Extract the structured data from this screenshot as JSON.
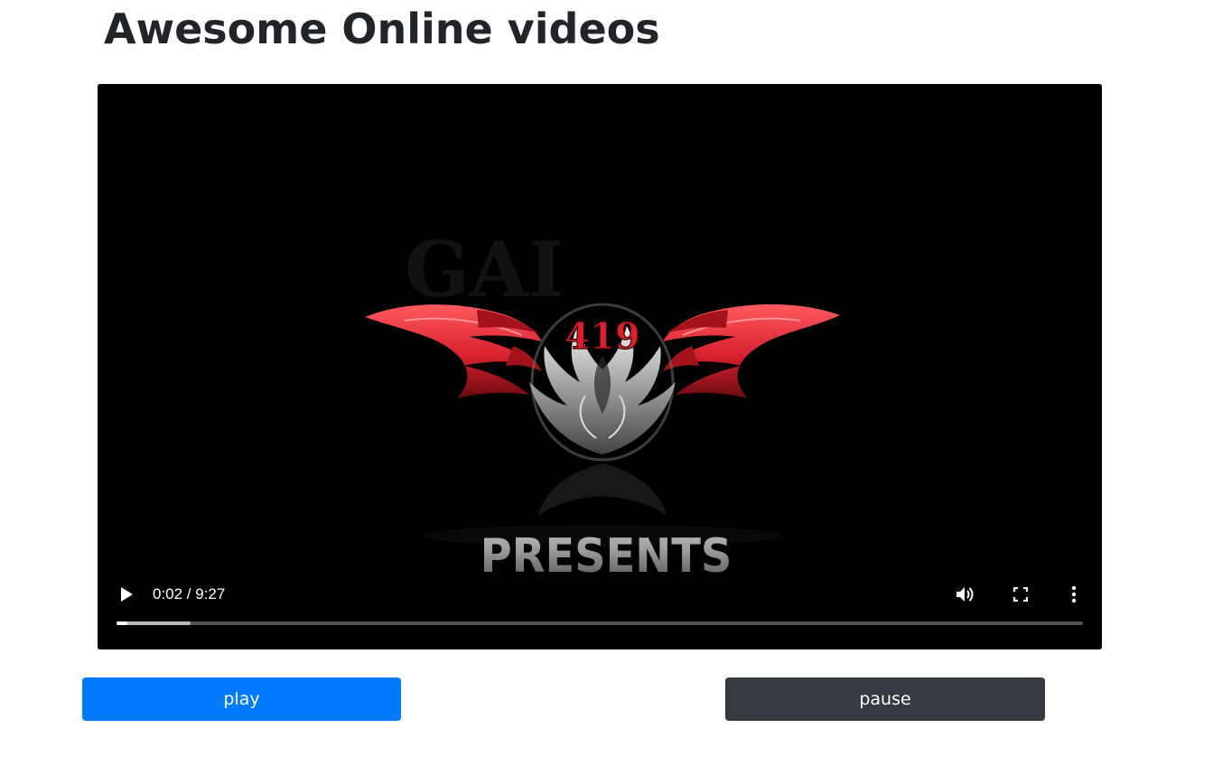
{
  "page": {
    "title": "Awesome Online videos"
  },
  "video": {
    "logo_number": "419",
    "logo_caption": "PRESENTS",
    "current_time": "0:02",
    "duration": "9:27",
    "time_display": "0:02 / 9:27",
    "played_fraction": 0.0035,
    "buffered_fraction": 0.077,
    "controls": {
      "play_icon": "play-icon",
      "volume_icon": "volume-icon",
      "fullscreen_icon": "fullscreen-icon",
      "more_icon": "more-vertical-icon"
    }
  },
  "buttons": {
    "play_label": "play",
    "pause_label": "pause"
  },
  "colors": {
    "play_button": "#007bff",
    "pause_button": "#343a40",
    "logo_red": "#d8202e",
    "title_text": "#212529"
  }
}
